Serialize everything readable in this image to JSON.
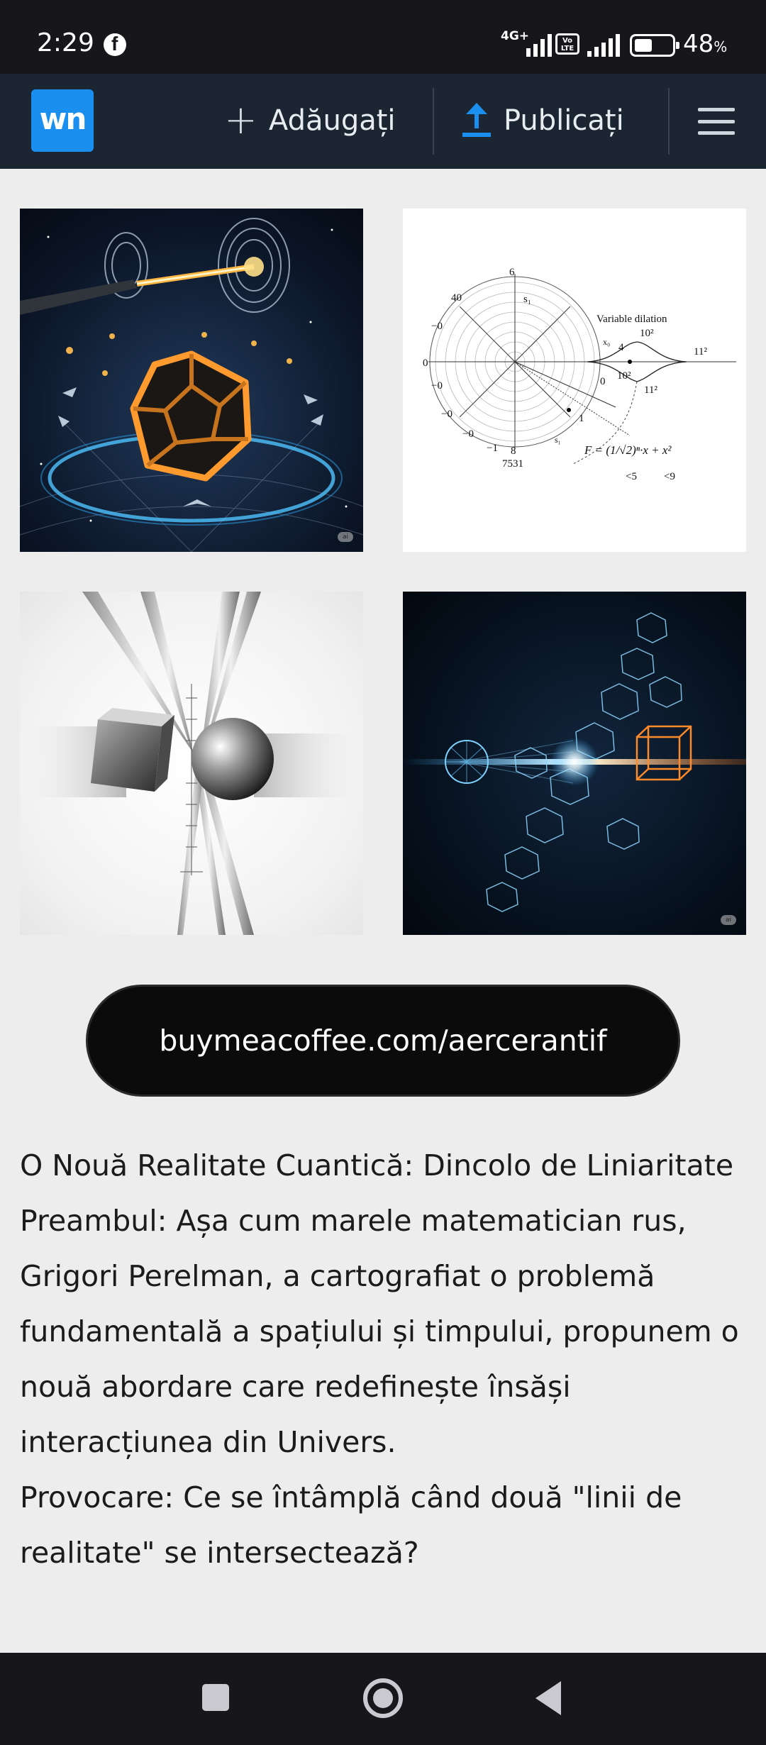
{
  "status_bar": {
    "time": "2:29",
    "network_1": "4G+",
    "volte": "Vo LTE",
    "battery_percent": "48",
    "battery_unit": "%",
    "battery_level": 0.48
  },
  "header": {
    "logo_text": "wn",
    "add_label": "Adăugați",
    "publish_label": "Publicați",
    "accent_color": "#1a8ff0"
  },
  "images": [
    {
      "icon": "photon-dodecahedron-image",
      "badge": "ai"
    },
    {
      "icon": "polar-diagram-image",
      "labels": {
        "variable_dilation": "Variable dilation",
        "formula": "F = (1/√2)ⁿ·x + x²",
        "lt5": "<5",
        "lt9": "<9",
        "n7531": "7531",
        "n6": "6",
        "n4": "4",
        "n40": "40",
        "n0": "0",
        "n1": "1",
        "n8": "8",
        "nm1": "−1",
        "nm0": "−0",
        "s1": "s₁",
        "x0": "x₀",
        "p102": "10²",
        "p112": "11²"
      }
    },
    {
      "icon": "metal-cube-sphere-image",
      "badge": ""
    },
    {
      "icon": "light-beam-crystal-image",
      "badge": "ai"
    }
  ],
  "donate_button": "buymeacoffee.com/aercerantif",
  "article": {
    "title_line": "O Nouă Realitate Cuantică: Dincolo de Liniaritate",
    "preamble": "Preambul: Așa cum marele matematician rus, Grigori Perelman, a cartografiat o problemă fundamentală a spațiului și timpului, propunem o nouă abordare care redefinește însăși interacțiunea din Univers.",
    "challenge": "Provocare: Ce se întâmplă când două \"linii de realitate\" se intersectează?"
  }
}
